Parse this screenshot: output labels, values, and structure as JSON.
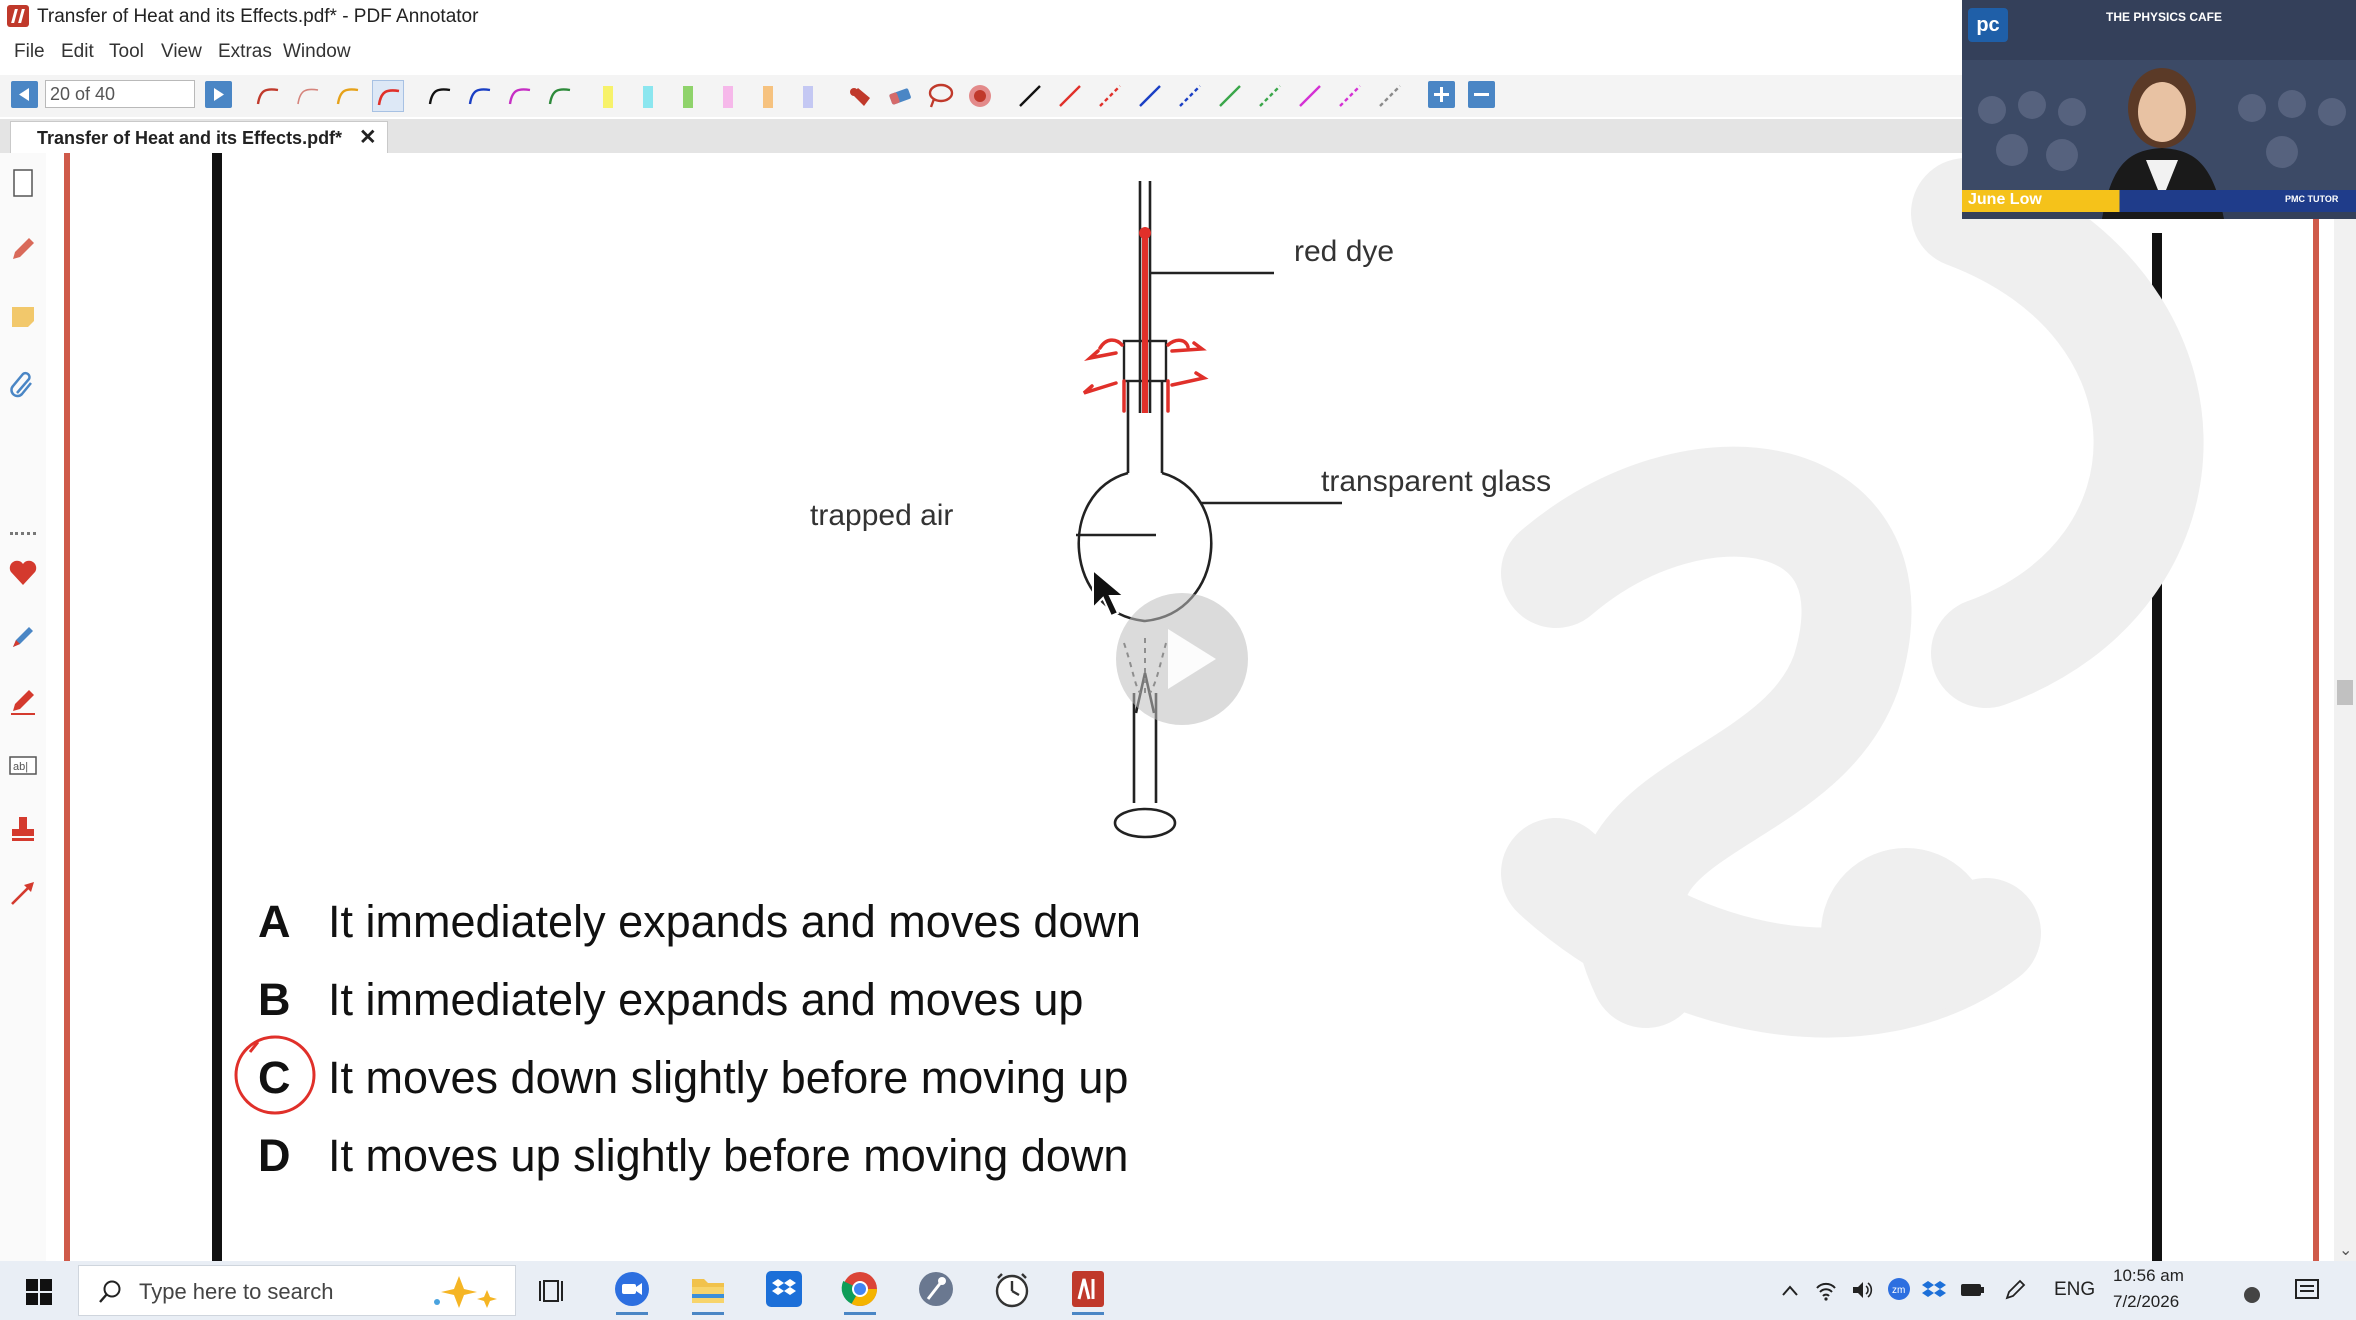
{
  "window": {
    "title": "Transfer of Heat and its Effects.pdf* - PDF Annotator"
  },
  "menu": [
    "File",
    "Edit",
    "Tool",
    "View",
    "Extras",
    "Window"
  ],
  "toolbar": {
    "page_field_value": "20 of 40",
    "pen_colors": [
      "#c0392b",
      "#c0392b",
      "#e6a21a",
      "#e0302a",
      "#111111",
      "#1a3fc4",
      "#c62fc4",
      "#2d8a3a"
    ],
    "highlighter_colors": [
      "#f7f26a",
      "#8be6ef",
      "#8fd36b",
      "#f6b8ea",
      "#f6c27f",
      "#c4c8f3"
    ],
    "line_colors": [
      "#111111",
      "#e0302a",
      "#e0302a",
      "#1a3fc4",
      "#1a3fc4",
      "#3aa64a",
      "#3aa64a",
      "#d431d4",
      "#d431d4",
      "#8a8a8a"
    ]
  },
  "tab": {
    "label": "Transfer of Heat and its Effects.pdf*",
    "close": "✕"
  },
  "document": {
    "labels": {
      "red_dye": "red dye",
      "transparent_glass": "transparent glass",
      "trapped_air": "trapped air"
    },
    "answers": [
      {
        "letter": "A",
        "text": "It immediately expands and moves down"
      },
      {
        "letter": "B",
        "text": "It immediately expands and moves up"
      },
      {
        "letter": "C",
        "text": "It moves down slightly before moving up",
        "circled": true
      },
      {
        "letter": "D",
        "text": "It moves up slightly before moving down"
      }
    ]
  },
  "webcam": {
    "logo": "pc",
    "brand": "THE PHYSICS CAFE",
    "presenter_name": "June Low",
    "badge": "PMC TUTOR"
  },
  "taskbar": {
    "search_placeholder": "Type here to search",
    "apps": [
      "task-view",
      "zoom",
      "file-explorer",
      "dropbox",
      "chrome",
      "steam",
      "clock",
      "pdf-annotator"
    ],
    "language": "ENG",
    "time": "10:56 am",
    "date": "7/2/2026"
  }
}
